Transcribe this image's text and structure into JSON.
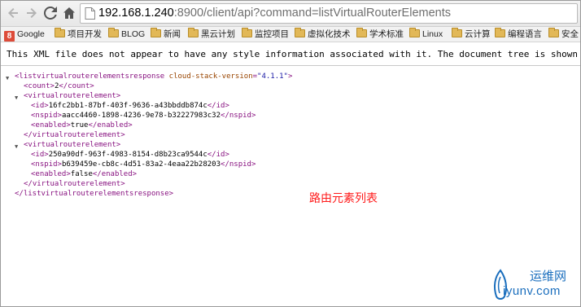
{
  "browser": {
    "url_host": "192.168.1.240",
    "url_rest": ":8900/client/api?command=listVirtualRouterElements"
  },
  "bookmarks": [
    {
      "label": "Google",
      "icon": "google-icon"
    },
    {
      "label": "项目开发",
      "icon": "folder-icon"
    },
    {
      "label": "BLOG",
      "icon": "folder-icon"
    },
    {
      "label": "新闻",
      "icon": "folder-icon"
    },
    {
      "label": "黑云计划",
      "icon": "folder-icon"
    },
    {
      "label": "监控项目",
      "icon": "folder-icon"
    },
    {
      "label": "虚拟化技术",
      "icon": "folder-icon"
    },
    {
      "label": "学术标准",
      "icon": "folder-icon"
    },
    {
      "label": "Linux",
      "icon": "folder-icon"
    },
    {
      "label": "云计算",
      "icon": "folder-icon"
    },
    {
      "label": "编程语言",
      "icon": "folder-icon"
    },
    {
      "label": "安全",
      "icon": "folder-icon"
    }
  ],
  "infobar": {
    "message": "This XML file does not appear to have any style information associated with it. The document tree is shown below."
  },
  "xml": {
    "root_open": "<listvirtualrouterelementsresponse",
    "root_attr_name": "cloud-stack-version",
    "root_attr_eq": "=",
    "root_attr_value": "\"4.1.1\"",
    "root_open_end": ">",
    "count_open": "<count>",
    "count_value": "2",
    "count_close": "</count>",
    "elem_open": "<virtualrouterelement>",
    "elem_close": "</virtualrouterelement>",
    "id_open": "<id>",
    "id_close": "</id>",
    "nspid_open": "<nspid>",
    "nspid_close": "</nspid>",
    "enabled_open": "<enabled>",
    "enabled_close": "</enabled>",
    "elements": [
      {
        "id": "16fc2bb1-87bf-403f-9636-a43bbddb874c",
        "nspid": "aacc4460-1898-4236-9e78-b32227983c32",
        "enabled": "true"
      },
      {
        "id": "250a90df-963f-4983-8154-d8b23ca9544c",
        "nspid": "b639459e-cb8c-4d51-83a2-4eaa22b28203",
        "enabled": "false"
      }
    ],
    "root_close": "</listvirtualrouterelementsresponse>"
  },
  "annotation": "路由元素列表",
  "watermark": {
    "cn": "运维网",
    "en": "iyunv.com"
  },
  "colors": {
    "tag": "#881280",
    "attr": "#994500",
    "attr_value": "#1a1aa6",
    "annotation": "#ff1a1a"
  }
}
